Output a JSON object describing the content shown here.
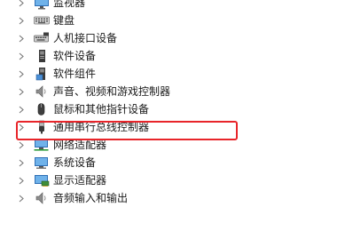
{
  "device_tree": {
    "items": [
      {
        "label": "监视器",
        "icon": "monitor-icon"
      },
      {
        "label": "键盘",
        "icon": "keyboard-icon"
      },
      {
        "label": "人机接口设备",
        "icon": "hid-icon"
      },
      {
        "label": "软件设备",
        "icon": "software-device-icon"
      },
      {
        "label": "软件组件",
        "icon": "software-component-icon"
      },
      {
        "label": "声音、视频和游戏控制器",
        "icon": "speaker-icon"
      },
      {
        "label": "鼠标和其他指针设备",
        "icon": "mouse-icon"
      },
      {
        "label": "通用串行总线控制器",
        "icon": "usb-icon"
      },
      {
        "label": "网络适配器",
        "icon": "network-icon"
      },
      {
        "label": "系统设备",
        "icon": "system-device-icon"
      },
      {
        "label": "显示适配器",
        "icon": "display-adapter-icon"
      },
      {
        "label": "音频输入和输出",
        "icon": "audio-io-icon"
      }
    ]
  },
  "colors": {
    "highlight": "#e8252a",
    "chevron": "#777777",
    "text": "#1a1a1a"
  }
}
